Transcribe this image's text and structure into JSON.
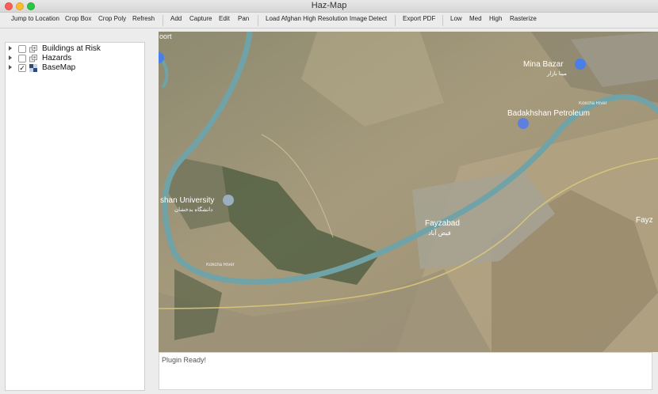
{
  "window": {
    "title": "Haz-Map"
  },
  "toolbar": {
    "items": [
      {
        "label": "Jump to Location"
      },
      {
        "label": "Crop Box"
      },
      {
        "label": "Crop Poly"
      },
      {
        "label": "Refresh"
      },
      {
        "label": "Add"
      },
      {
        "label": "Capture"
      },
      {
        "label": "Edit"
      },
      {
        "label": "Pan"
      },
      {
        "label": "Load Afghan High Resolution Image"
      },
      {
        "label": "Detect"
      },
      {
        "label": "Export PDF"
      },
      {
        "label": "Low"
      },
      {
        "label": "Med"
      },
      {
        "label": "High"
      },
      {
        "label": "Rasterize"
      }
    ]
  },
  "layers": [
    {
      "label": "Buildings at Risk",
      "checked": false,
      "icon": "vector-layer-icon"
    },
    {
      "label": "Hazards",
      "checked": false,
      "icon": "vector-layer-icon"
    },
    {
      "label": "BaseMap",
      "checked": true,
      "icon": "raster-layer-icon",
      "check_glyph": "✓"
    }
  ],
  "map": {
    "labels": {
      "mina_bazar": "Mina Bazar",
      "mina_bazar_local": "مینا بازار",
      "petroleum": "Badakhshan Petroleum",
      "university": "shan University",
      "university_local": "دانشگاه بدخشان",
      "fayzabad": "Fayzabad",
      "fayzabad_local": "فیض آباد",
      "fayz_edge": "Fayz",
      "river": "Kokcha River",
      "top_left_fragment": "oort"
    },
    "colors": {
      "river": "#6fa3a8",
      "terrain": "#a89b7e",
      "farmland": "#4a5a3c"
    }
  },
  "status": {
    "message": "Plugin Ready!"
  }
}
